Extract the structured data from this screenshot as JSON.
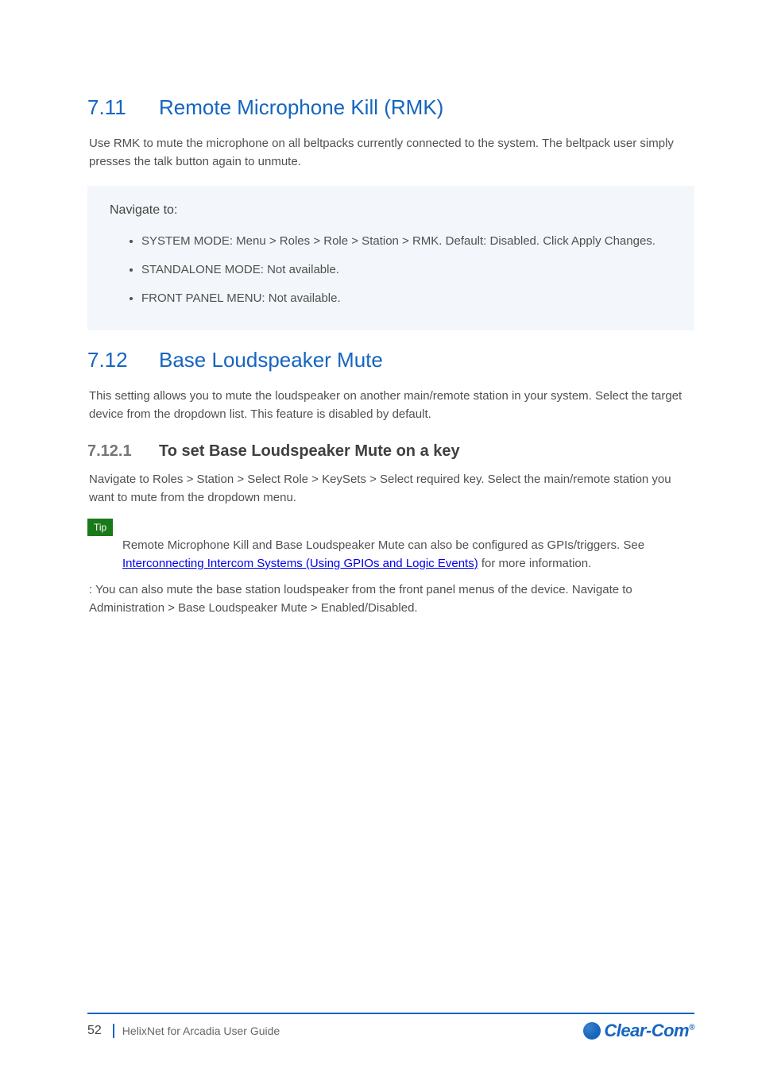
{
  "section1": {
    "number": "7.11",
    "title": "Remote Microphone Kill (RMK)",
    "body": "Use RMK to mute the microphone on all beltpacks currently connected to the system. The beltpack user simply presses the talk button again to unmute.",
    "panel_title": "Navigate to:",
    "nav_items": [
      "SYSTEM MODE: Menu > Roles > Role > Station > RMK. Default: Disabled. Click Apply Changes.",
      "STANDALONE MODE: Not available.",
      "FRONT PANEL MENU: Not available."
    ]
  },
  "section2": {
    "number": "7.12",
    "title": "Base Loudspeaker Mute",
    "body": "This setting allows you to mute the loudspeaker on another main/remote station in your system. Select the target device from the dropdown list. This feature is disabled by default.",
    "sub_number": "7.12.1",
    "sub_title": "To set Base Loudspeaker Mute on a key",
    "sub_body": "Navigate to Roles > Station > Select Role > KeySets > Select required key. Select the main/remote station you want to mute from the dropdown menu.",
    "tip_label": "Tip",
    "tip_text1": "Remote Microphone Kill and Base Loudspeaker Mute can also be configured as GPIs/triggers. See ",
    "tip_link_text": "Interconnecting Intercom Systems (Using GPIOs and Logic Events)",
    "tip_text2": " for more information.",
    "body2": ": You can also mute the base station loudspeaker from the front panel menus of the device. Navigate to Administration > Base Loudspeaker Mute > Enabled/Disabled."
  },
  "footer": {
    "page": "52",
    "doc": "HelixNet for Arcadia User Guide",
    "logo": "Clear-Com"
  }
}
